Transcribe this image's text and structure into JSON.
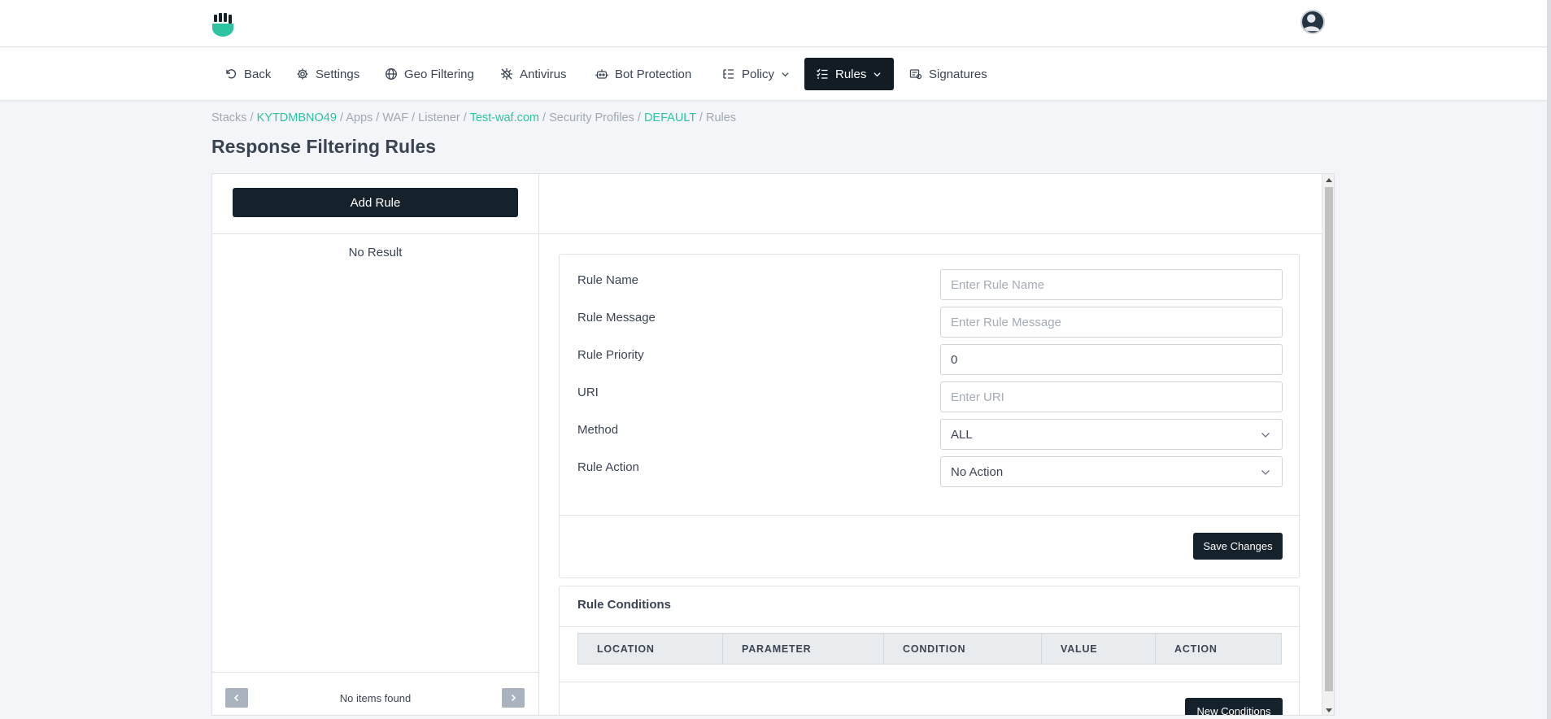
{
  "header": {
    "logo_icon": "shield-fist-logo",
    "avatar_icon": "user-avatar"
  },
  "nav": {
    "items": [
      {
        "label": "Back",
        "icon": "undo-icon"
      },
      {
        "label": "Settings",
        "icon": "gear-icon"
      },
      {
        "label": "Geo Filtering",
        "icon": "globe-icon"
      },
      {
        "label": "Antivirus",
        "icon": "virus-icon"
      },
      {
        "label": "Bot Protection",
        "icon": "robot-icon"
      },
      {
        "label": "Policy",
        "icon": "list-tree-icon"
      },
      {
        "label": "Rules",
        "icon": "checklist-icon"
      },
      {
        "label": "Signatures",
        "icon": "signature-icon"
      }
    ]
  },
  "breadcrumb": {
    "items": [
      "Stacks",
      "KYTDMBNO49",
      "Apps",
      "WAF",
      "Listener",
      "Test-waf.com",
      "Security Profiles",
      "DEFAULT",
      "Rules"
    ],
    "separator": " / "
  },
  "page": {
    "title": "Response Filtering Rules"
  },
  "left": {
    "add_label": "Add Rule",
    "empty_text": "No Result",
    "footer_text": "No items found"
  },
  "form": {
    "rule_name": {
      "label": "Rule Name",
      "placeholder": "Enter Rule Name",
      "value": ""
    },
    "rule_message": {
      "label": "Rule Message",
      "placeholder": "Enter Rule Message",
      "value": ""
    },
    "rule_priority": {
      "label": "Rule Priority",
      "value": "0"
    },
    "uri": {
      "label": "URI",
      "placeholder": "Enter URI",
      "value": ""
    },
    "method": {
      "label": "Method",
      "value": "ALL"
    },
    "rule_action": {
      "label": "Rule Action",
      "value": "No Action"
    },
    "save_label": "Save Changes"
  },
  "conditions": {
    "title": "Rule Conditions",
    "columns": [
      "LOCATION",
      "PARAMETER",
      "CONDITION",
      "VALUE",
      "ACTION"
    ],
    "new_label": "New Conditions"
  },
  "colors": {
    "accent": "#2ec4a1",
    "dark": "#15222c"
  }
}
